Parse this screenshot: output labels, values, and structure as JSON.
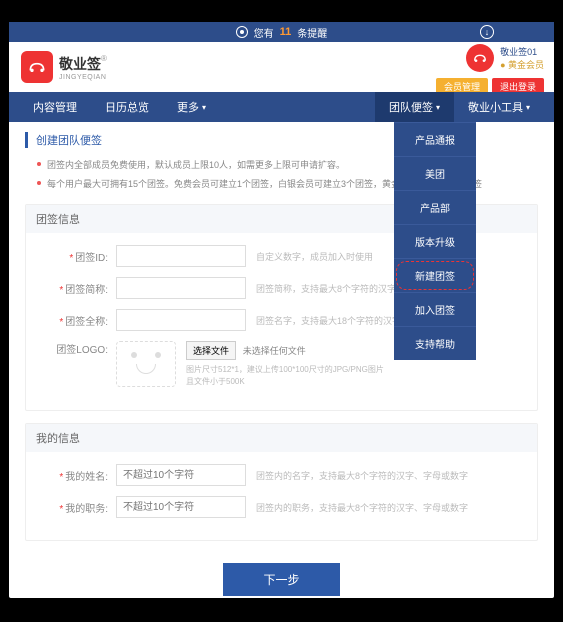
{
  "topicons": [
    "●",
    "◆",
    "●",
    "✿"
  ],
  "banner": {
    "prefix": "您有",
    "count": "11",
    "suffix": "条提醒"
  },
  "brand": {
    "cn": "敬业签",
    "en": "JINGYEQIAN",
    "reg": "®"
  },
  "user": {
    "name": "敬业签01",
    "vip": "● 黄金会员"
  },
  "topbtns": {
    "vip": "会员管理",
    "logout": "退出登录"
  },
  "nav": {
    "left": [
      "内容管理",
      "日历总览",
      "更多"
    ],
    "right": [
      "团队便签",
      "敬业小工具"
    ]
  },
  "dropdown": [
    "产品通报",
    "美团",
    "产品部",
    "版本升级",
    "新建团签",
    "加入团签",
    "支持帮助"
  ],
  "pageTitle": "创建团队便签",
  "notes": [
    "团签内全部成员免费使用，默认成员上限10人，如需更多上限可申请扩容。",
    "每个用户最大可拥有15个团签。免费会员可建立1个团签，白银会员可建立3个团签，黄金会员可建立10个团签"
  ],
  "panel1": {
    "title": "团签信息",
    "rows": [
      {
        "label": "团签ID:",
        "req": true,
        "hint": "自定义数字，成员加入时使用"
      },
      {
        "label": "团签简称:",
        "req": true,
        "hint": "团签简称，支持最大8个字符的汉字、字母或数字"
      },
      {
        "label": "团签全称:",
        "req": true,
        "hint": "团签名字，支持最大18个字符的汉字、字母或数字"
      }
    ],
    "logo": {
      "label": "团签LOGO:",
      "btn": "选择文件",
      "txt": "未选择任何文件",
      "hint1": "图片尺寸512*1，建议上传100*100尺寸的JPG/PNG图片",
      "hint2": "且文件小于500K"
    }
  },
  "panel2": {
    "title": "我的信息",
    "rows": [
      {
        "label": "我的姓名:",
        "req": true,
        "ph": "不超过10个字符",
        "hint": "团签内的名字，支持最大8个字符的汉字、字母或数字"
      },
      {
        "label": "我的职务:",
        "req": true,
        "ph": "不超过10个字符",
        "hint": "团签内的职务，支持最大8个字符的汉字、字母或数字"
      }
    ]
  },
  "submit": "下一步"
}
